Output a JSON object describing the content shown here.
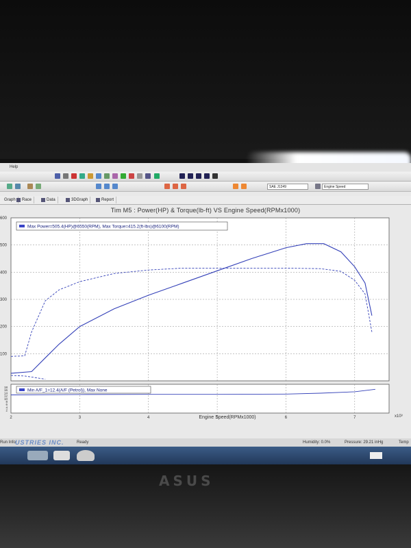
{
  "window": {
    "menu_label": "Help",
    "units_select": "SAE J1349",
    "xaxis_select": "Engine Speed",
    "tabs": [
      "Graph",
      "Race",
      "Data",
      "3DGraph",
      "Report"
    ]
  },
  "status": {
    "left_label": "Run Info",
    "ready": "Ready",
    "watermark": "USTRIES INC.",
    "humidity": "Humidity: 0.0%",
    "pressure": "Pressure: 29.21 inHg",
    "temp": "Temp"
  },
  "bezel": {
    "brand": "ASUS"
  },
  "colors": {
    "accent": "#3a45c8",
    "line": "#3340b8",
    "grid": "#8a8a8a"
  },
  "chart_data": {
    "type": "line",
    "title": "Tim M5 : Power(HP) & Torque(lb-ft) VS Engine Speed(RPMx1000)",
    "xlabel": "Engine Speed(RPMx1000)",
    "x_exponent": "x10³",
    "xlim": [
      2,
      7.5
    ],
    "x_ticks": [
      2,
      3,
      4,
      5,
      6,
      7
    ],
    "ylim": [
      0,
      600
    ],
    "y_ticks": [
      100,
      200,
      300,
      400,
      500,
      600
    ],
    "y_tick_labels": [
      "100",
      "200",
      "300",
      "400",
      "500",
      "600"
    ],
    "legend": "Max Power=505.4(HP)@6550(RPM), Max Torque=415.2(ft-lbs)@6100(RPM)",
    "series": [
      {
        "style": "solid",
        "x": [
          2.0,
          2.3,
          2.5,
          2.7,
          3.0,
          3.5,
          4.0,
          4.5,
          5.0,
          5.5,
          6.0,
          6.3,
          6.55,
          6.8,
          7.0,
          7.15,
          7.25
        ],
        "values": [
          28,
          34,
          85,
          135,
          200,
          265,
          315,
          360,
          405,
          450,
          490,
          505,
          505,
          475,
          420,
          360,
          240
        ]
      },
      {
        "style": "dashed",
        "x": [
          2.0,
          2.2,
          2.3,
          2.5,
          2.7,
          3.0,
          3.5,
          4.0,
          4.5,
          5.0,
          5.5,
          6.0,
          6.5,
          6.8,
          7.0,
          7.15,
          7.25
        ],
        "values": [
          90,
          92,
          180,
          295,
          335,
          365,
          395,
          408,
          415,
          415,
          415,
          415,
          413,
          403,
          370,
          320,
          180
        ]
      },
      {
        "style": "dashed-low",
        "x": [
          2.0,
          2.2,
          2.3,
          2.5
        ],
        "values": [
          20,
          18,
          14,
          6
        ]
      }
    ],
    "subplot": {
      "legend": "Min A/F_1=12.4(A/F (Petrol)), Max None",
      "y_ticks": [
        2,
        4,
        6,
        8,
        10,
        12,
        14,
        16,
        18
      ],
      "ylim": [
        0,
        20
      ],
      "series": [
        {
          "x": [
            2.0,
            3.0,
            4.0,
            5.0,
            6.0,
            6.5,
            7.0,
            7.3
          ],
          "values": [
            12.6,
            12.9,
            13.0,
            13.0,
            13.2,
            13.8,
            14.8,
            16.5
          ]
        }
      ]
    }
  }
}
